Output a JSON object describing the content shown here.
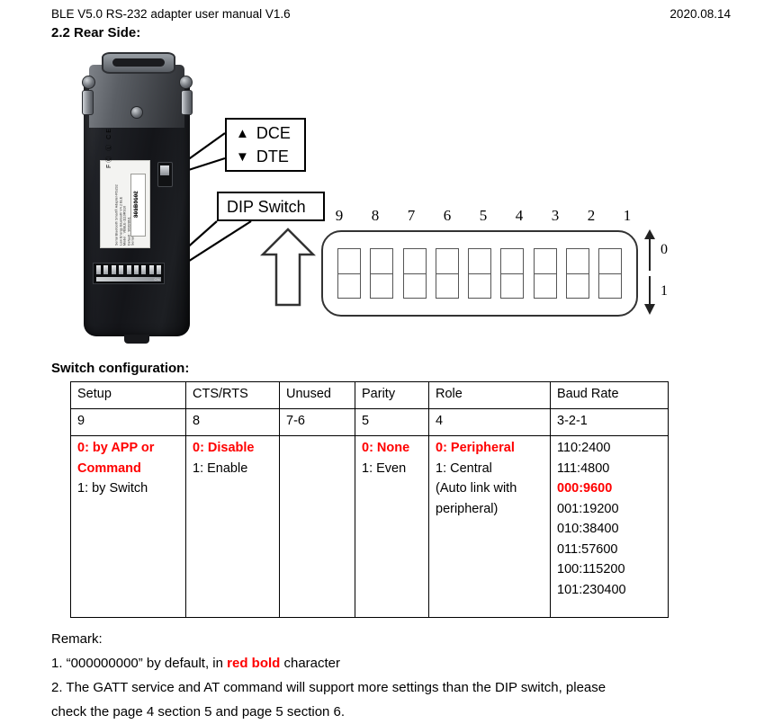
{
  "header": {
    "left_text": "BLE V5.0 RS-232 adapter user manual V1.6",
    "date": "2020.08.14"
  },
  "section": {
    "title": "2.2 Rear Side:"
  },
  "figure": {
    "callout_dce": {
      "up_symbol": "▲",
      "up_label": "DCE",
      "down_symbol": "▼",
      "down_label": "DTE"
    },
    "callout_dip": {
      "label": "DIP Switch"
    },
    "dip_switch_numbers": [
      "1",
      "2",
      "3",
      "4",
      "5",
      "6",
      "7",
      "8",
      "9"
    ],
    "dip_legend": {
      "up_value": "0",
      "down_value": "1"
    },
    "device_label": {
      "line1": "Serial Bluetooth Smart® Adapter-RS232",
      "line2": "Low Energy Bluetooth V4.2 BLE",
      "line3": "Model : VBBLE-1110RS10",
      "line4": "Default : 9600/8N1",
      "line5": "Serial no:",
      "serial": "801B0102",
      "made_in": "Made in Taiwan",
      "marks": "FⒸ  Ⓛ  CE",
      "dip_on_mark": "ON"
    }
  },
  "switch_config": {
    "title": "Switch configuration:",
    "columns": [
      "Setup",
      "CTS/RTS",
      "Unused",
      "Parity",
      "Role",
      "Baud Rate"
    ],
    "bits": [
      "9",
      "8",
      "7-6",
      "5",
      "4",
      "3-2-1"
    ],
    "cells": {
      "setup": [
        {
          "text": "0: by APP or",
          "red": true
        },
        {
          "text": "Command",
          "red": true
        },
        {
          "text": "1: by Switch",
          "red": false
        }
      ],
      "cts_rts": [
        {
          "text": "0: Disable",
          "red": true
        },
        {
          "text": "1: Enable",
          "red": false
        }
      ],
      "unused": [],
      "parity": [
        {
          "text": "0: None",
          "red": true
        },
        {
          "text": "1: Even",
          "red": false
        }
      ],
      "role": [
        {
          "text": "0: Peripheral",
          "red": true
        },
        {
          "text": "1: Central",
          "red": false
        },
        {
          "text": "(Auto link with",
          "red": false
        },
        {
          "text": "peripheral)",
          "red": false
        }
      ],
      "baud_rate": [
        {
          "text": "110:2400",
          "red": false
        },
        {
          "text": "111:4800",
          "red": false
        },
        {
          "text": "000:9600",
          "red": true
        },
        {
          "text": "001:19200",
          "red": false
        },
        {
          "text": "010:38400",
          "red": false
        },
        {
          "text": "011:57600",
          "red": false
        },
        {
          "text": "100:115200",
          "red": false
        },
        {
          "text": "101:230400",
          "red": false
        }
      ]
    }
  },
  "remark": {
    "heading": "Remark:",
    "item1_prefix": "1. “000000000” by default, in ",
    "item1_red": "red bold",
    "item1_suffix": " character",
    "item2_line1": "2. The GATT service and AT command will support more settings than the DIP switch, please",
    "item2_line2": "check the page 4 section 5 and page 5 section 6."
  },
  "colors": {
    "highlight_red": "#ff0000",
    "text": "#000000",
    "page_background": "#ffffff"
  }
}
